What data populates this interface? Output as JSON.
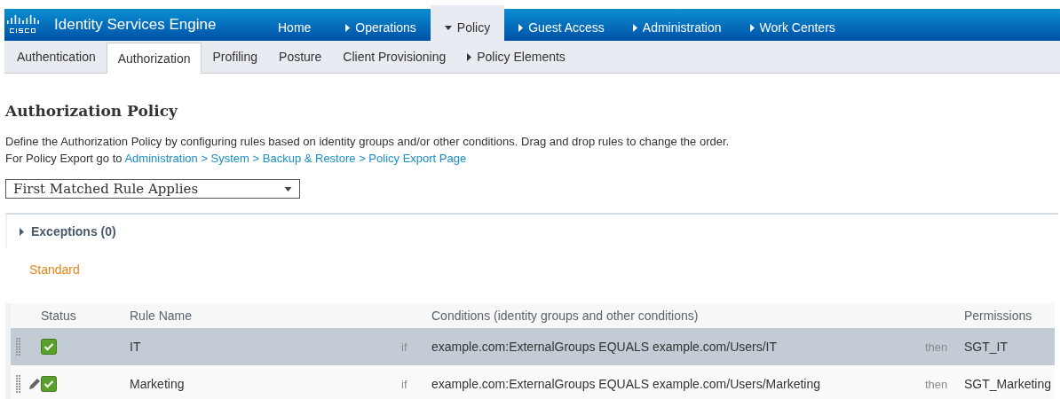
{
  "header": {
    "product": "Identity Services Engine"
  },
  "nav": [
    {
      "label": "Home",
      "has_menu": false,
      "selected": false
    },
    {
      "label": "Operations",
      "has_menu": true,
      "selected": false
    },
    {
      "label": "Policy",
      "has_menu": true,
      "selected": true
    },
    {
      "label": "Guest Access",
      "has_menu": true,
      "selected": false
    },
    {
      "label": "Administration",
      "has_menu": true,
      "selected": false
    },
    {
      "label": "Work Centers",
      "has_menu": true,
      "selected": false
    }
  ],
  "subnav": [
    {
      "label": "Authentication",
      "has_menu": false,
      "selected": false
    },
    {
      "label": "Authorization",
      "has_menu": false,
      "selected": true
    },
    {
      "label": "Profiling",
      "has_menu": false,
      "selected": false
    },
    {
      "label": "Posture",
      "has_menu": false,
      "selected": false
    },
    {
      "label": "Client Provisioning",
      "has_menu": false,
      "selected": false
    },
    {
      "label": "Policy Elements",
      "has_menu": true,
      "selected": false
    }
  ],
  "page": {
    "title": "Authorization Policy",
    "description": "Define the Authorization Policy by configuring rules based on identity groups and/or other conditions. Drag and drop rules to change the order.",
    "export_prefix": "For Policy Export go to",
    "export_link": "Administration > System > Backup & Restore > Policy Export Page"
  },
  "match_mode": {
    "value": "First Matched Rule Applies"
  },
  "exceptions": {
    "label": "Exceptions (0)",
    "expanded": false
  },
  "section": "Standard",
  "table": {
    "columns": [
      "Status",
      "Rule Name",
      "Conditions (identity groups and other conditions)",
      "Permissions"
    ],
    "rows": [
      {
        "name": "IT",
        "enabled": true,
        "selected": true,
        "edit_icon": false,
        "if": "if",
        "condition": "example.com:ExternalGroups EQUALS example.com/Users/IT",
        "then": "then",
        "permission": "SGT_IT"
      },
      {
        "name": "Marketing",
        "enabled": true,
        "selected": false,
        "edit_icon": true,
        "if": "if",
        "condition": "example.com:ExternalGroups EQUALS example.com/Users/Marketing",
        "then": "then",
        "permission": "SGT_Marketing"
      }
    ]
  }
}
